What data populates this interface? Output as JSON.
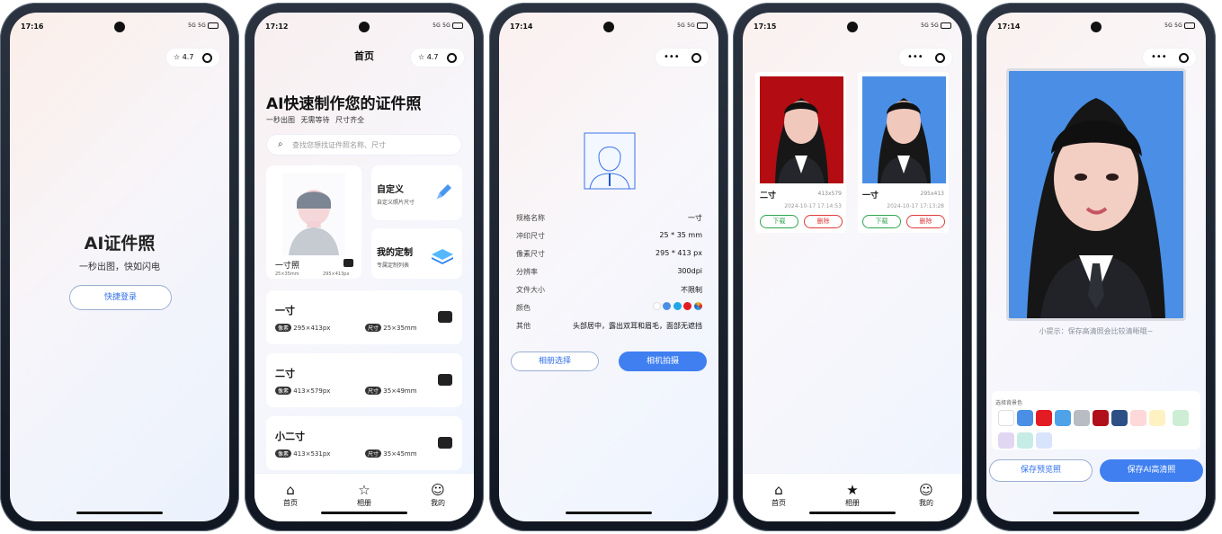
{
  "status": {
    "times": [
      "17:16",
      "17:12",
      "17:14",
      "17:15",
      "17:14"
    ],
    "signal": "5G 5G"
  },
  "screen1": {
    "title": "AI证件照",
    "subtitle": "一秒出图，快如闪电",
    "login_button": "快捷登录",
    "rating": "4.7"
  },
  "screen2": {
    "nav_title": "首页",
    "rating": "4.7",
    "hero_title": "AI快速制作您的证件照",
    "hero_tags": [
      "一秒出图",
      "无需等待",
      "尺寸齐全"
    ],
    "search_placeholder": "查找您想找证件照名称、尺寸",
    "one_inch_card": {
      "title": "一寸照",
      "size_mm": "25×35mm",
      "size_px": "295×413px"
    },
    "custom_card": {
      "title": "自定义",
      "subtitle": "自定义照片尺寸"
    },
    "mine_card": {
      "title": "我的定制",
      "subtitle": "专属定制列表"
    },
    "items": [
      {
        "title": "一寸",
        "pixel_label": "像素",
        "pixel": "295×413px",
        "size_label": "尺寸",
        "size": "25×35mm"
      },
      {
        "title": "二寸",
        "pixel_label": "像素",
        "pixel": "413×579px",
        "size_label": "尺寸",
        "size": "35×49mm"
      },
      {
        "title": "小二寸",
        "pixel_label": "像素",
        "pixel": "413×531px",
        "size_label": "尺寸",
        "size": "35×45mm"
      }
    ],
    "tabs": [
      "首页",
      "相册",
      "我的"
    ]
  },
  "screen3": {
    "specs": [
      {
        "label": "规格名称",
        "value": "一寸"
      },
      {
        "label": "冲印尺寸",
        "value": "25 * 35 mm"
      },
      {
        "label": "像素尺寸",
        "value": "295 * 413 px"
      },
      {
        "label": "分辨率",
        "value": "300dpi"
      },
      {
        "label": "文件大小",
        "value": "不限制"
      },
      {
        "label": "颜色",
        "value": ""
      },
      {
        "label": "其他",
        "value": "头部居中，露出双耳和眉毛，面部无遮挡"
      }
    ],
    "color_dots": [
      "#ffffff",
      "#4a8fe5",
      "#1fa8e8",
      "#e31b24",
      "#f0c419"
    ],
    "album_button": "相册选择",
    "camera_button": "相机拍摄"
  },
  "screen4": {
    "photos": [
      {
        "title": "二寸",
        "size": "413x579",
        "date": "2024-10-17 17:14:53",
        "download": "下载",
        "delete": "删除",
        "bg": "#b30c12"
      },
      {
        "title": "一寸",
        "size": "295x413",
        "date": "2024-10-17 17:13:28",
        "download": "下载",
        "delete": "删除",
        "bg": "#4a8fe5"
      }
    ],
    "tabs": [
      "首页",
      "相册",
      "我的"
    ]
  },
  "screen5": {
    "tip": "小提示：保存高清照会比较清晰哦~",
    "bg_label": "选择背景色",
    "bg_colors": [
      "#ffffff",
      "#4a8fe5",
      "#e31b24",
      "#4ea3e8",
      "#b8bcc3",
      "#b10f1b",
      "#2d4f86",
      "#ffd8d9",
      "#fff2c2",
      "#cdeed4",
      "#e2d7f3",
      "#c6ece6",
      "#d8e4fb"
    ],
    "preview_button": "保存预览照",
    "hd_button": "保存AI高清照"
  },
  "accent": "#3f7ff0"
}
